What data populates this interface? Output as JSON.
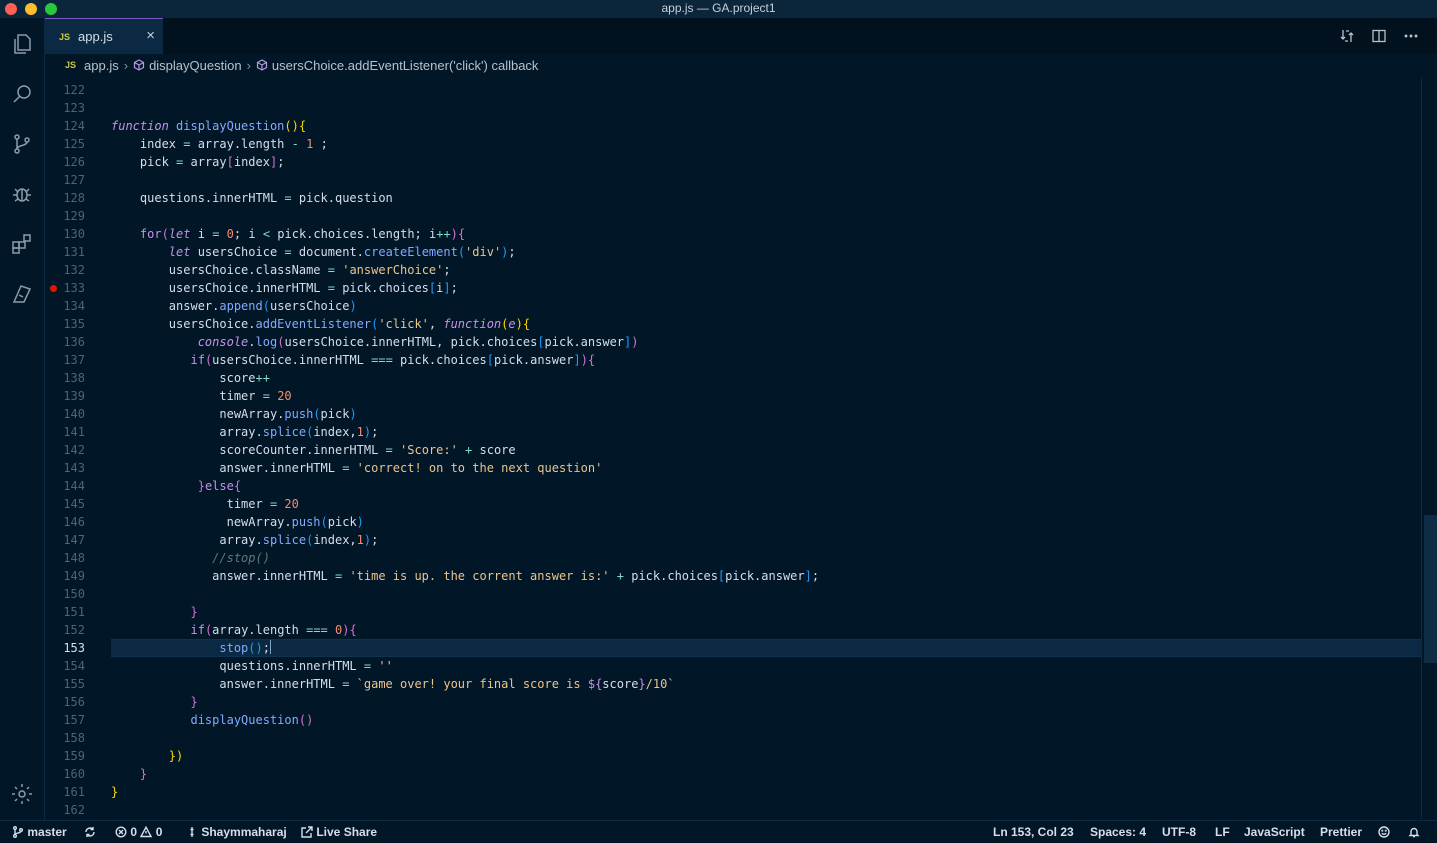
{
  "window": {
    "title": "app.js — GA.project1"
  },
  "tab": {
    "badge": "JS",
    "label": "app.js",
    "close": "×"
  },
  "breadcrumb": {
    "badge": "JS",
    "file": "app.js",
    "item1": "displayQuestion",
    "item2": "usersChoice.addEventListener('click') callback"
  },
  "activity_bar": [
    "files-icon",
    "search-icon",
    "source-control-icon",
    "debug-icon",
    "extensions-icon",
    "remote-icon",
    "settings-gear-icon"
  ],
  "editor": {
    "current_line": 153,
    "breakpoint_line": 133,
    "lines": [
      {
        "n": "122",
        "t": []
      },
      {
        "n": "123",
        "t": []
      },
      {
        "n": "124",
        "t": [
          [
            "k",
            "function"
          ],
          [
            "p",
            " "
          ],
          [
            "f",
            "displayQuestion"
          ],
          [
            "b1",
            "(){"
          ]
        ]
      },
      {
        "n": "125",
        "t": [
          [
            "p",
            "    index "
          ],
          [
            "o",
            "="
          ],
          [
            "p",
            " array.length "
          ],
          [
            "o",
            "-"
          ],
          [
            "p",
            " "
          ],
          [
            "n",
            "1"
          ],
          [
            "p",
            " ;"
          ]
        ]
      },
      {
        "n": "126",
        "t": [
          [
            "p",
            "    pick "
          ],
          [
            "o",
            "="
          ],
          [
            "p",
            " array"
          ],
          [
            "b2",
            "["
          ],
          [
            "p",
            "index"
          ],
          [
            "b2",
            "]"
          ],
          [
            "p",
            ";"
          ]
        ]
      },
      {
        "n": "127",
        "t": []
      },
      {
        "n": "128",
        "t": [
          [
            "p",
            "    questions.innerHTML "
          ],
          [
            "o",
            "="
          ],
          [
            "p",
            " pick.question"
          ]
        ]
      },
      {
        "n": "129",
        "t": []
      },
      {
        "n": "130",
        "t": [
          [
            "p",
            "    "
          ],
          [
            "kp",
            "for"
          ],
          [
            "b2",
            "("
          ],
          [
            "k",
            "let"
          ],
          [
            "p",
            " i "
          ],
          [
            "o",
            "="
          ],
          [
            "p",
            " "
          ],
          [
            "n",
            "0"
          ],
          [
            "p",
            "; i "
          ],
          [
            "o",
            "<"
          ],
          [
            "p",
            " pick.choices.length; i"
          ],
          [
            "o",
            "++"
          ],
          [
            "b2",
            "){"
          ]
        ]
      },
      {
        "n": "131",
        "t": [
          [
            "p",
            "        "
          ],
          [
            "k",
            "let"
          ],
          [
            "p",
            " usersChoice "
          ],
          [
            "o",
            "="
          ],
          [
            "p",
            " document."
          ],
          [
            "f",
            "createElement"
          ],
          [
            "b3",
            "("
          ],
          [
            "s",
            "'div'"
          ],
          [
            "b3",
            ")"
          ],
          [
            "p",
            ";"
          ]
        ]
      },
      {
        "n": "132",
        "t": [
          [
            "p",
            "        usersChoice.className "
          ],
          [
            "o",
            "="
          ],
          [
            "p",
            " "
          ],
          [
            "s",
            "'answerChoice'"
          ],
          [
            "p",
            ";"
          ]
        ]
      },
      {
        "n": "133",
        "t": [
          [
            "p",
            "        usersChoice.innerHTML "
          ],
          [
            "o",
            "="
          ],
          [
            "p",
            " pick.choices"
          ],
          [
            "b3",
            "["
          ],
          [
            "p",
            "i"
          ],
          [
            "b3",
            "]"
          ],
          [
            "p",
            ";"
          ]
        ]
      },
      {
        "n": "134",
        "t": [
          [
            "p",
            "        answer."
          ],
          [
            "f",
            "append"
          ],
          [
            "b3",
            "("
          ],
          [
            "p",
            "usersChoice"
          ],
          [
            "b3",
            ")"
          ]
        ]
      },
      {
        "n": "135",
        "t": [
          [
            "p",
            "        usersChoice."
          ],
          [
            "f",
            "addEventListener"
          ],
          [
            "b3",
            "("
          ],
          [
            "s",
            "'click'"
          ],
          [
            "p",
            ", "
          ],
          [
            "k",
            "function"
          ],
          [
            "b1",
            "("
          ],
          [
            "k",
            "e"
          ],
          [
            "b1",
            "){"
          ]
        ]
      },
      {
        "n": "136",
        "t": [
          [
            "p",
            "            "
          ],
          [
            "k",
            "console"
          ],
          [
            "p",
            "."
          ],
          [
            "f",
            "log"
          ],
          [
            "b2",
            "("
          ],
          [
            "p",
            "usersChoice.innerHTML, pick.choices"
          ],
          [
            "b3",
            "["
          ],
          [
            "p",
            "pick.answer"
          ],
          [
            "b3",
            "]"
          ],
          [
            "b2",
            ")"
          ]
        ]
      },
      {
        "n": "137",
        "t": [
          [
            "p",
            "           "
          ],
          [
            "kp",
            "if"
          ],
          [
            "b2",
            "("
          ],
          [
            "p",
            "usersChoice.innerHTML "
          ],
          [
            "o",
            "==="
          ],
          [
            "p",
            " pick.choices"
          ],
          [
            "b3",
            "["
          ],
          [
            "p",
            "pick.answer"
          ],
          [
            "b3",
            "]"
          ],
          [
            "b2",
            "){"
          ]
        ]
      },
      {
        "n": "138",
        "t": [
          [
            "p",
            "               score"
          ],
          [
            "o",
            "++"
          ]
        ]
      },
      {
        "n": "139",
        "t": [
          [
            "p",
            "               timer "
          ],
          [
            "o",
            "="
          ],
          [
            "p",
            " "
          ],
          [
            "n",
            "20"
          ]
        ]
      },
      {
        "n": "140",
        "t": [
          [
            "p",
            "               newArray."
          ],
          [
            "f",
            "push"
          ],
          [
            "b3",
            "("
          ],
          [
            "p",
            "pick"
          ],
          [
            "b3",
            ")"
          ]
        ]
      },
      {
        "n": "141",
        "t": [
          [
            "p",
            "               array."
          ],
          [
            "f",
            "splice"
          ],
          [
            "b3",
            "("
          ],
          [
            "p",
            "index,"
          ],
          [
            "n",
            "1"
          ],
          [
            "b3",
            ")"
          ],
          [
            "p",
            ";"
          ]
        ]
      },
      {
        "n": "142",
        "t": [
          [
            "p",
            "               scoreCounter.innerHTML "
          ],
          [
            "o",
            "="
          ],
          [
            "p",
            " "
          ],
          [
            "s",
            "'Score:'"
          ],
          [
            "p",
            " "
          ],
          [
            "o",
            "+"
          ],
          [
            "p",
            " score"
          ]
        ]
      },
      {
        "n": "143",
        "t": [
          [
            "p",
            "               answer.innerHTML "
          ],
          [
            "o",
            "="
          ],
          [
            "p",
            " "
          ],
          [
            "s",
            "'correct! on to the next question'"
          ]
        ]
      },
      {
        "n": "144",
        "t": [
          [
            "p",
            "            "
          ],
          [
            "b2",
            "}"
          ],
          [
            "kp",
            "else"
          ],
          [
            "b2",
            "{"
          ]
        ]
      },
      {
        "n": "145",
        "t": [
          [
            "p",
            "                timer "
          ],
          [
            "o",
            "="
          ],
          [
            "p",
            " "
          ],
          [
            "n",
            "20"
          ]
        ]
      },
      {
        "n": "146",
        "t": [
          [
            "p",
            "                newArray."
          ],
          [
            "f",
            "push"
          ],
          [
            "b3",
            "("
          ],
          [
            "p",
            "pick"
          ],
          [
            "b3",
            ")"
          ]
        ]
      },
      {
        "n": "147",
        "t": [
          [
            "p",
            "               array."
          ],
          [
            "f",
            "splice"
          ],
          [
            "b3",
            "("
          ],
          [
            "p",
            "index,"
          ],
          [
            "n",
            "1"
          ],
          [
            "b3",
            ")"
          ],
          [
            "p",
            ";"
          ]
        ]
      },
      {
        "n": "148",
        "t": [
          [
            "p",
            "              "
          ],
          [
            "c",
            "//stop()"
          ]
        ]
      },
      {
        "n": "149",
        "t": [
          [
            "p",
            "              answer.innerHTML "
          ],
          [
            "o",
            "="
          ],
          [
            "p",
            " "
          ],
          [
            "s",
            "'time is up. the corrent answer is:'"
          ],
          [
            "p",
            " "
          ],
          [
            "o",
            "+"
          ],
          [
            "p",
            " pick.choices"
          ],
          [
            "b3",
            "["
          ],
          [
            "p",
            "pick.answer"
          ],
          [
            "b3",
            "]"
          ],
          [
            "p",
            ";"
          ]
        ]
      },
      {
        "n": "150",
        "t": []
      },
      {
        "n": "151",
        "t": [
          [
            "p",
            "           "
          ],
          [
            "b2",
            "}"
          ]
        ]
      },
      {
        "n": "152",
        "t": [
          [
            "p",
            "           "
          ],
          [
            "kp",
            "if"
          ],
          [
            "b2",
            "("
          ],
          [
            "p",
            "array.length "
          ],
          [
            "o",
            "==="
          ],
          [
            "p",
            " "
          ],
          [
            "n",
            "0"
          ],
          [
            "b2",
            "){"
          ]
        ]
      },
      {
        "n": "153",
        "t": [
          [
            "p",
            "               "
          ],
          [
            "f",
            "stop"
          ],
          [
            "b3",
            "()"
          ],
          [
            "p",
            ";"
          ]
        ]
      },
      {
        "n": "154",
        "t": [
          [
            "p",
            "               questions.innerHTML "
          ],
          [
            "o",
            "="
          ],
          [
            "p",
            " "
          ],
          [
            "s",
            "''"
          ]
        ]
      },
      {
        "n": "155",
        "t": [
          [
            "p",
            "               answer.innerHTML "
          ],
          [
            "o",
            "="
          ],
          [
            "p",
            " "
          ],
          [
            "s",
            "`game over! your final score is "
          ],
          [
            "kp",
            "${"
          ],
          [
            "p",
            "score"
          ],
          [
            "kp",
            "}"
          ],
          [
            "s",
            "/10`"
          ]
        ]
      },
      {
        "n": "156",
        "t": [
          [
            "p",
            "           "
          ],
          [
            "b2",
            "}"
          ]
        ]
      },
      {
        "n": "157",
        "t": [
          [
            "p",
            "           "
          ],
          [
            "f",
            "displayQuestion"
          ],
          [
            "b2",
            "()"
          ]
        ]
      },
      {
        "n": "158",
        "t": []
      },
      {
        "n": "159",
        "t": [
          [
            "p",
            "        "
          ],
          [
            "b1",
            "})"
          ]
        ]
      },
      {
        "n": "160",
        "t": [
          [
            "p",
            "    "
          ],
          [
            "b2",
            "}"
          ]
        ]
      },
      {
        "n": "161",
        "t": [
          [
            "b1",
            "}"
          ]
        ]
      },
      {
        "n": "162",
        "t": []
      }
    ]
  },
  "statusbar": {
    "branch": "master",
    "errors": "0",
    "warnings": "0",
    "user": "Shaymmaharaj",
    "live_share": "Live Share",
    "position": "Ln 153, Col 23",
    "spaces": "Spaces: 4",
    "encoding": "UTF-8",
    "eol": "LF",
    "language": "JavaScript",
    "formatter": "Prettier"
  },
  "colors": {
    "background": "#011627",
    "accent": "#7e57c2",
    "current_line": "#0b2942",
    "breakpoint": "#e51400"
  }
}
